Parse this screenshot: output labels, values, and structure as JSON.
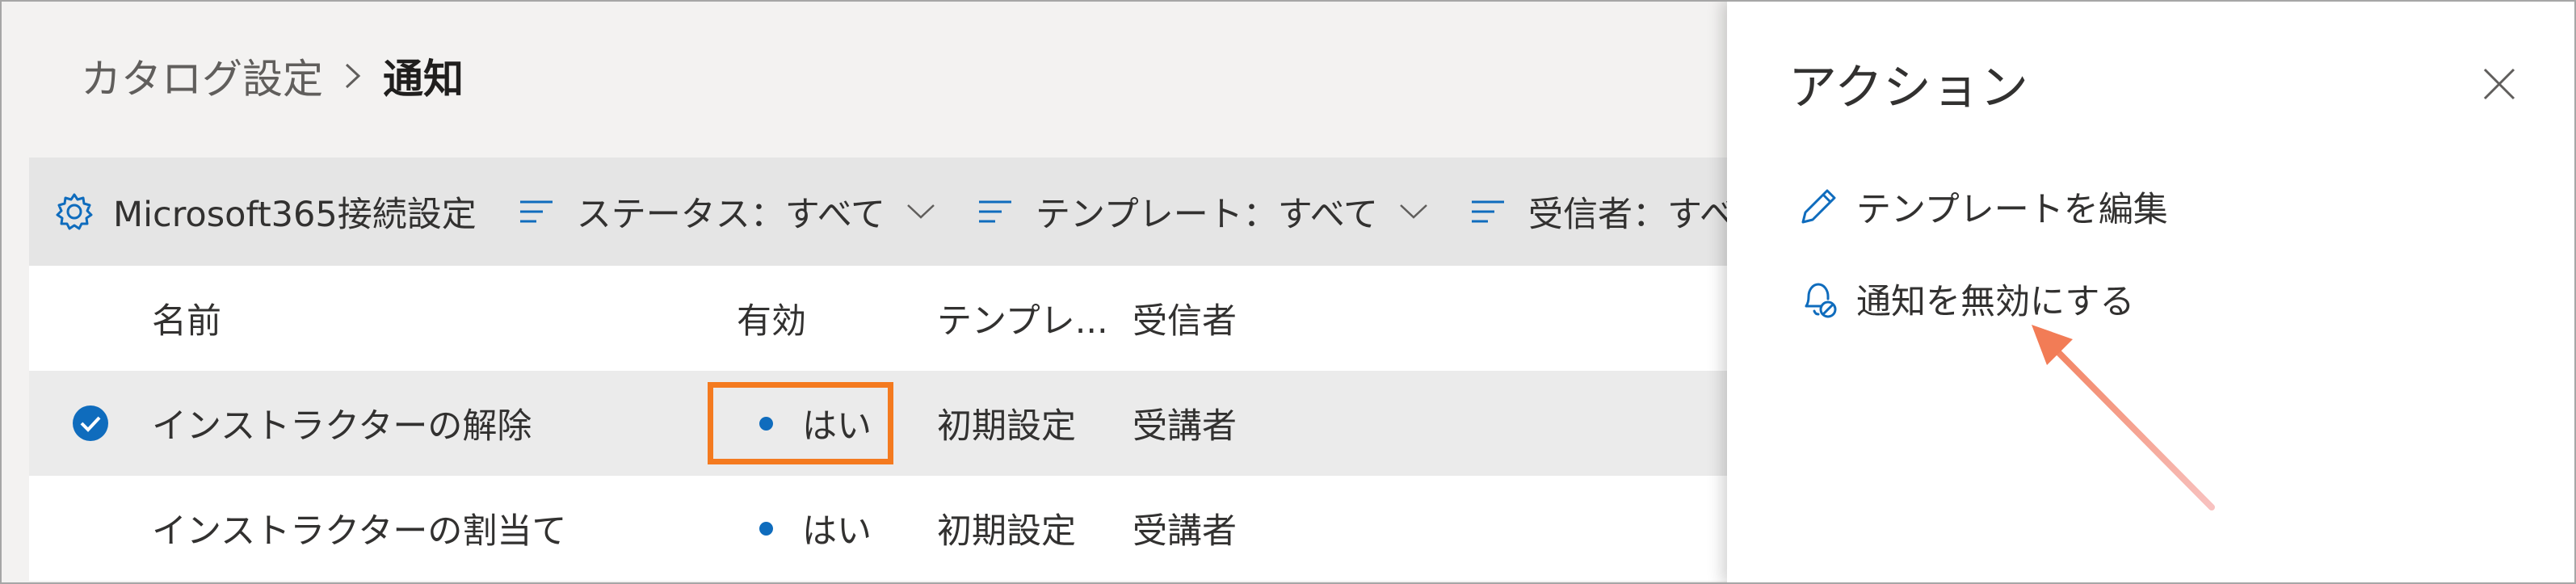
{
  "breadcrumb": {
    "parent": "カタログ設定",
    "current": "通知"
  },
  "toolbar": {
    "m365_settings": "Microsoft365接続設定",
    "status_filter": "ステータス：すべて",
    "template_filter": "テンプレート：すべて",
    "recipient_filter": "受信者：すべて"
  },
  "table": {
    "columns": [
      "名前",
      "有効",
      "テンプレ...",
      "受信者"
    ],
    "rows": [
      {
        "name": "インストラクターの解除",
        "active": "はい",
        "template": "初期設定",
        "recipient": "受講者",
        "selected": true
      },
      {
        "name": "インストラクターの割当て",
        "active": "はい",
        "template": "初期設定",
        "recipient": "受講者",
        "selected": false
      }
    ]
  },
  "panel": {
    "title": "アクション",
    "actions": [
      {
        "label": "テンプレートを編集",
        "icon": "pencil-icon"
      },
      {
        "label": "通知を無効にする",
        "icon": "bell-off-icon"
      }
    ]
  },
  "colors": {
    "accent": "#0f6cbd",
    "highlight": "#f47a1f",
    "arrow": "#f4877a"
  }
}
